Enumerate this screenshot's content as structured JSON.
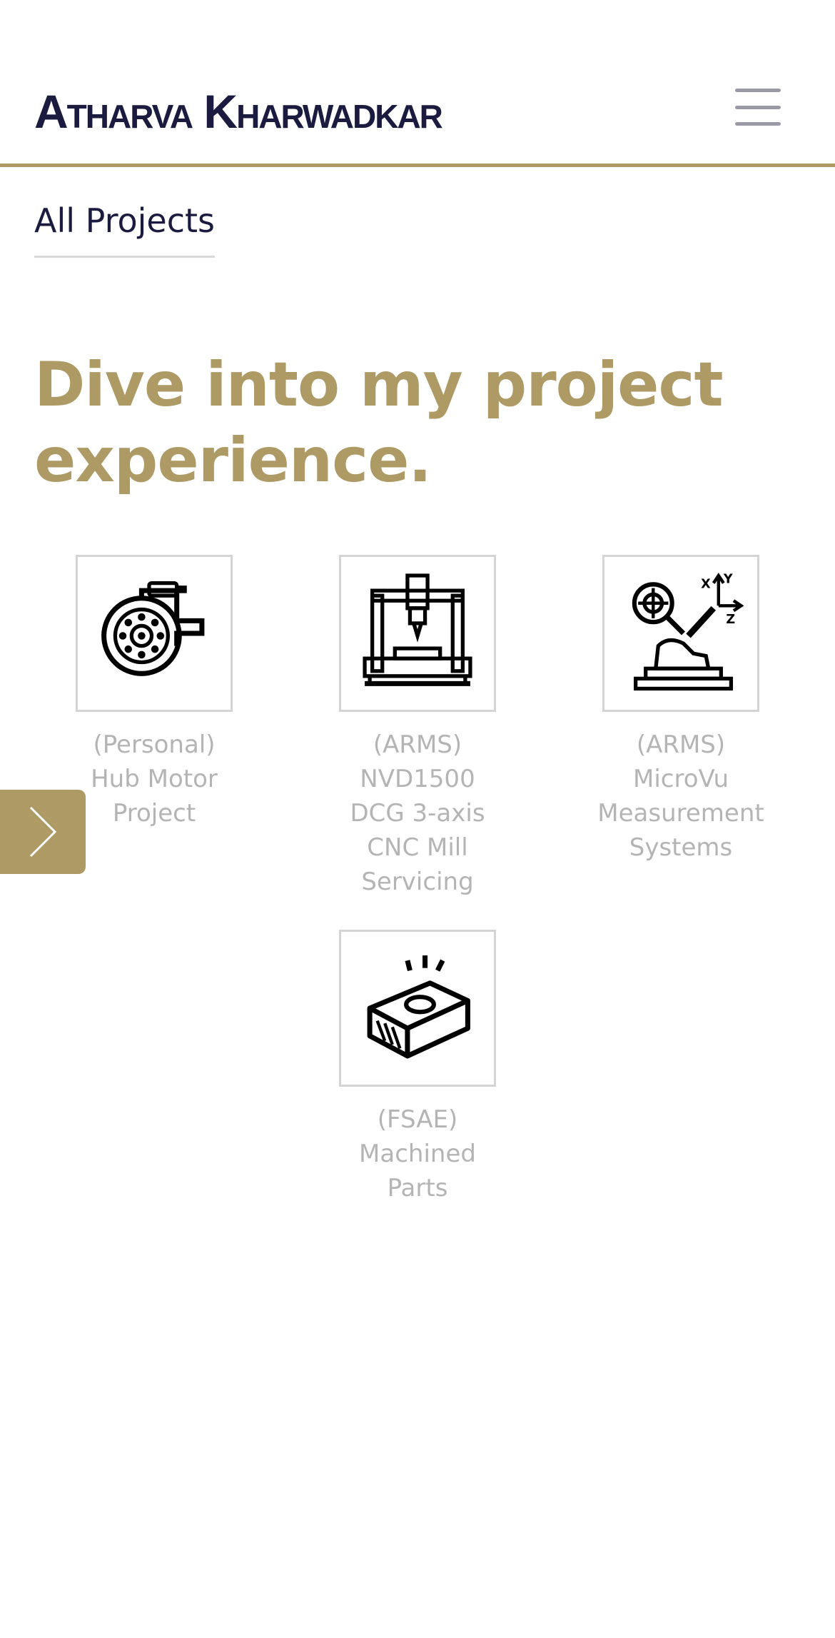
{
  "header": {
    "site_title": "Atharva Kharwadkar",
    "menu_icon": "hamburger-menu-icon"
  },
  "nav": {
    "all_projects_label": "All Projects"
  },
  "hero": {
    "heading": "Dive into my project experience."
  },
  "colors": {
    "accent_gold": "#ad9a65",
    "title_navy": "#1a1b3e",
    "label_gray": "#b4b4b4"
  },
  "projects": [
    {
      "label_lines": [
        "(Personal)",
        "Hub Motor",
        "Project"
      ],
      "icon": "hub-motor-icon"
    },
    {
      "label_lines": [
        "(ARMS)",
        "NVD1500",
        "DCG 3-axis",
        "CNC Mill",
        "Servicing"
      ],
      "icon": "cnc-mill-icon"
    },
    {
      "label_lines": [
        "(ARMS)",
        "MicroVu",
        "Measurement",
        "Systems"
      ],
      "icon": "measurement-icon"
    },
    {
      "label_lines": [
        "(FSAE)",
        "Machined",
        "Parts"
      ],
      "icon": "machined-part-icon"
    }
  ],
  "carousel": {
    "next_icon": "chevron-right-icon"
  }
}
